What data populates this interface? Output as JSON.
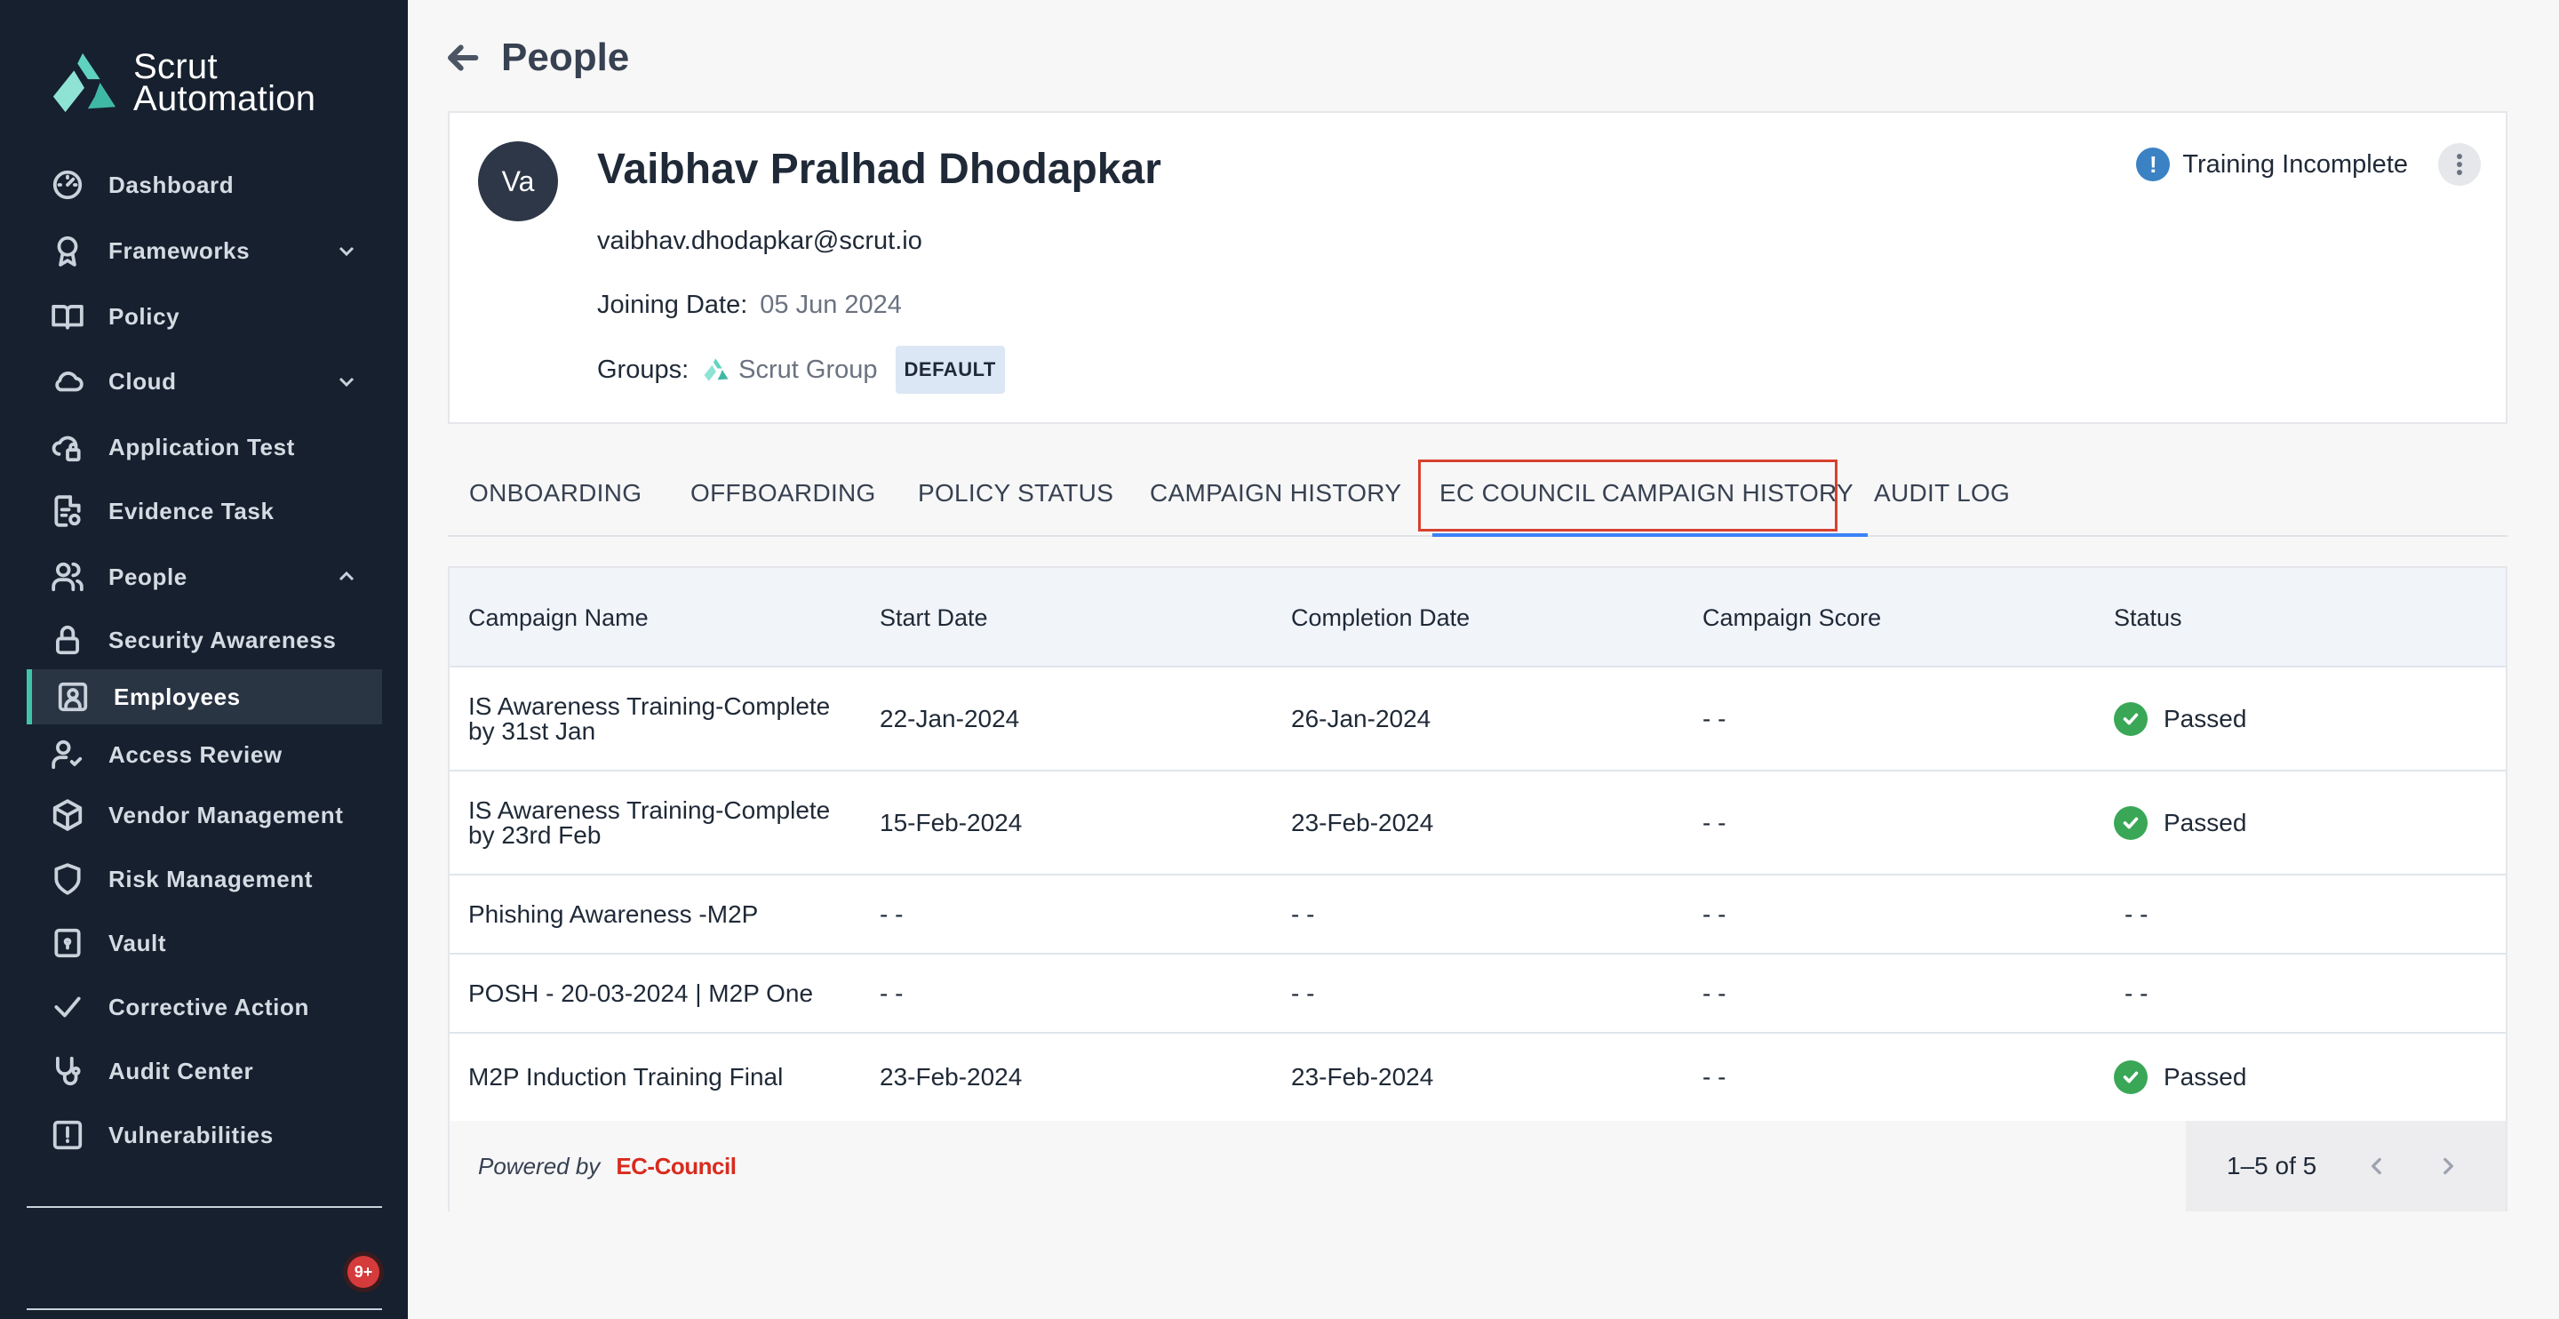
{
  "sidebar": {
    "logo_line1": "Scrut",
    "logo_line2": "Automation",
    "items": [
      {
        "label": "Dashboard",
        "icon": "dashboard-icon"
      },
      {
        "label": "Frameworks",
        "icon": "award-icon",
        "expandable": true
      },
      {
        "label": "Policy",
        "icon": "book-icon"
      },
      {
        "label": "Cloud",
        "icon": "cloud-icon",
        "expandable": true
      },
      {
        "label": "Application Test",
        "icon": "cloud-lock-icon"
      },
      {
        "label": "Evidence Task",
        "icon": "file-task-icon"
      },
      {
        "label": "People",
        "icon": "people-icon",
        "expanded": true
      },
      {
        "label": "Security Awareness",
        "icon": "lock-icon"
      },
      {
        "label": "Employees",
        "icon": "user-badge-icon",
        "active": true
      },
      {
        "label": "Access Review",
        "icon": "user-check-icon"
      },
      {
        "label": "Vendor Management",
        "icon": "cube-icon"
      },
      {
        "label": "Risk Management",
        "icon": "shield-icon"
      },
      {
        "label": "Vault",
        "icon": "vault-icon"
      },
      {
        "label": "Corrective Action",
        "icon": "check-icon"
      },
      {
        "label": "Audit Center",
        "icon": "stethoscope-icon"
      },
      {
        "label": "Vulnerabilities",
        "icon": "alert-square-icon"
      }
    ],
    "notification_count": "9+"
  },
  "header": {
    "title": "People"
  },
  "profile": {
    "initials": "Va",
    "name": "Vaibhav Pralhad Dhodapkar",
    "email": "vaibhav.dhodapkar@scrut.io",
    "joining_label": "Joining Date:",
    "joining_date": "05 Jun 2024",
    "groups_label": "Groups:",
    "group_name": "Scrut Group",
    "group_badge": "DEFAULT",
    "status": "Training Incomplete",
    "status_color": "#3b82c4"
  },
  "tabs": [
    {
      "label": "ONBOARDING"
    },
    {
      "label": "OFFBOARDING"
    },
    {
      "label": "POLICY STATUS"
    },
    {
      "label": "CAMPAIGN HISTORY"
    },
    {
      "label": "EC COUNCIL CAMPAIGN HISTORY",
      "active": true
    },
    {
      "label": "AUDIT LOG"
    }
  ],
  "table": {
    "columns": [
      "Campaign Name",
      "Start Date",
      "Completion Date",
      "Campaign Score",
      "Status"
    ],
    "rows": [
      {
        "name": "IS Awareness Training-Complete by 31st Jan",
        "start": "22-Jan-2024",
        "completion": "26-Jan-2024",
        "score": "- -",
        "status": "Passed"
      },
      {
        "name": "IS Awareness Training-Complete by 23rd Feb",
        "start": "15-Feb-2024",
        "completion": "23-Feb-2024",
        "score": "- -",
        "status": "Passed"
      },
      {
        "name": "Phishing Awareness -M2P",
        "start": "- -",
        "completion": "- -",
        "score": "- -",
        "status": "- -"
      },
      {
        "name": "POSH - 20-03-2024 | M2P One",
        "start": "- -",
        "completion": "- -",
        "score": "- -",
        "status": "- -"
      },
      {
        "name": "M2P Induction Training Final",
        "start": "23-Feb-2024",
        "completion": "23-Feb-2024",
        "score": "- -",
        "status": "Passed"
      }
    ],
    "passed_color": "#3aa757"
  },
  "footer": {
    "powered_by": "Powered by",
    "brand": "EC-Council",
    "brand_color": "#d92b1e",
    "pagination": "1–5 of 5"
  },
  "colors": {
    "sidebar_bg": "#16202e",
    "accent": "#40c4aa",
    "tab_underline": "#3b82f6",
    "highlight_box": "#d7412f"
  }
}
